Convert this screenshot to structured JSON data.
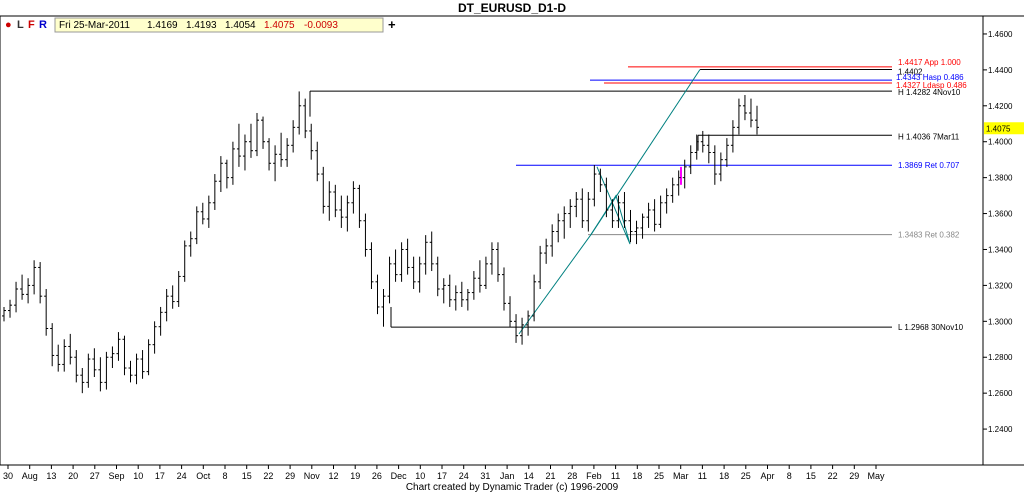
{
  "title": "DT_EURUSD_D1-D",
  "toolbar": {
    "dot": "●",
    "l": "L",
    "f": "F",
    "r": "R",
    "plus": "+"
  },
  "ohlc": {
    "date": "Fri 25-Mar-2011",
    "open": "1.4169",
    "high": "1.4193",
    "low": "1.4054",
    "close": "1.4075",
    "change": "-0.0093"
  },
  "footer": "Chart created by Dynamic Trader  (c) 1996-2009",
  "colors": {
    "background": "#ffffff",
    "ohlc_box": "#ffffcc",
    "price_label_bg": "#ffff00",
    "red_line": "#ff0000",
    "blue_line": "#0000ff",
    "teal_line": "#008080",
    "gray_line": "#888888",
    "magenta_bar": "#ff00ff"
  },
  "chart_data": {
    "type": "ohlc",
    "ylim": [
      1.22,
      1.47
    ],
    "y_ticks": [
      "1.4600",
      "1.4400",
      "1.4200",
      "1.4000",
      "1.3800",
      "1.3600",
      "1.3400",
      "1.3200",
      "1.3000",
      "1.2800",
      "1.2600",
      "1.2400"
    ],
    "x_ticks": [
      "30",
      "Aug",
      "13",
      "20",
      "27",
      "Sep",
      "10",
      "17",
      "24",
      "Oct",
      "8",
      "15",
      "22",
      "29",
      "Nov",
      "12",
      "19",
      "26",
      "Dec",
      "10",
      "17",
      "24",
      "31",
      "Jan",
      "14",
      "21",
      "28",
      "Feb",
      "11",
      "18",
      "25",
      "Mar",
      "11",
      "18",
      "25",
      "Apr",
      "8",
      "15",
      "22",
      "29",
      "May"
    ],
    "last_price": "1.4075",
    "bars": [
      [
        1.303,
        1.308,
        1.3,
        1.306
      ],
      [
        1.306,
        1.312,
        1.302,
        1.309
      ],
      [
        1.309,
        1.322,
        1.305,
        1.318
      ],
      [
        1.318,
        1.326,
        1.312,
        1.315
      ],
      [
        1.315,
        1.324,
        1.31,
        1.32
      ],
      [
        1.32,
        1.334,
        1.315,
        1.33
      ],
      [
        1.33,
        1.333,
        1.31,
        1.314
      ],
      [
        1.314,
        1.318,
        1.292,
        1.296
      ],
      [
        1.296,
        1.299,
        1.275,
        1.281
      ],
      [
        1.281,
        1.287,
        1.272,
        1.276
      ],
      [
        1.276,
        1.29,
        1.272,
        1.286
      ],
      [
        1.286,
        1.293,
        1.276,
        1.28
      ],
      [
        1.28,
        1.284,
        1.266,
        1.27
      ],
      [
        1.27,
        1.274,
        1.26,
        1.266
      ],
      [
        1.266,
        1.282,
        1.263,
        1.279
      ],
      [
        1.279,
        1.285,
        1.269,
        1.273
      ],
      [
        1.273,
        1.28,
        1.261,
        1.266
      ],
      [
        1.266,
        1.283,
        1.262,
        1.28
      ],
      [
        1.28,
        1.286,
        1.274,
        1.282
      ],
      [
        1.282,
        1.294,
        1.278,
        1.29
      ],
      [
        1.29,
        1.292,
        1.27,
        1.274
      ],
      [
        1.274,
        1.278,
        1.266,
        1.27
      ],
      [
        1.27,
        1.282,
        1.265,
        1.279
      ],
      [
        1.279,
        1.284,
        1.268,
        1.272
      ],
      [
        1.272,
        1.29,
        1.27,
        1.287
      ],
      [
        1.287,
        1.3,
        1.282,
        1.297
      ],
      [
        1.297,
        1.308,
        1.292,
        1.305
      ],
      [
        1.305,
        1.318,
        1.3,
        1.314
      ],
      [
        1.314,
        1.32,
        1.307,
        1.311
      ],
      [
        1.311,
        1.328,
        1.308,
        1.325
      ],
      [
        1.325,
        1.345,
        1.322,
        1.342
      ],
      [
        1.342,
        1.35,
        1.336,
        1.346
      ],
      [
        1.346,
        1.364,
        1.343,
        1.361
      ],
      [
        1.361,
        1.366,
        1.354,
        1.357
      ],
      [
        1.357,
        1.37,
        1.352,
        1.366
      ],
      [
        1.366,
        1.382,
        1.362,
        1.378
      ],
      [
        1.378,
        1.392,
        1.372,
        1.388
      ],
      [
        1.388,
        1.39,
        1.374,
        1.38
      ],
      [
        1.38,
        1.4,
        1.376,
        1.396
      ],
      [
        1.396,
        1.41,
        1.386,
        1.392
      ],
      [
        1.392,
        1.404,
        1.384,
        1.4
      ],
      [
        1.4,
        1.41,
        1.391,
        1.395
      ],
      [
        1.395,
        1.416,
        1.392,
        1.412
      ],
      [
        1.412,
        1.414,
        1.396,
        1.4
      ],
      [
        1.4,
        1.402,
        1.384,
        1.388
      ],
      [
        1.388,
        1.398,
        1.378,
        1.393
      ],
      [
        1.393,
        1.405,
        1.386,
        1.39
      ],
      [
        1.39,
        1.402,
        1.386,
        1.398
      ],
      [
        1.398,
        1.412,
        1.394,
        1.408
      ],
      [
        1.408,
        1.428,
        1.404,
        1.42
      ],
      [
        1.42,
        1.424,
        1.402,
        1.406
      ],
      [
        1.406,
        1.41,
        1.39,
        1.395
      ],
      [
        1.395,
        1.4,
        1.378,
        1.382
      ],
      [
        1.382,
        1.386,
        1.36,
        1.364
      ],
      [
        1.364,
        1.378,
        1.356,
        1.372
      ],
      [
        1.372,
        1.376,
        1.358,
        1.362
      ],
      [
        1.362,
        1.37,
        1.352,
        1.358
      ],
      [
        1.358,
        1.37,
        1.35,
        1.366
      ],
      [
        1.366,
        1.378,
        1.36,
        1.374
      ],
      [
        1.374,
        1.376,
        1.352,
        1.356
      ],
      [
        1.356,
        1.36,
        1.336,
        1.34
      ],
      [
        1.34,
        1.344,
        1.318,
        1.322
      ],
      [
        1.322,
        1.326,
        1.304,
        1.308
      ],
      [
        1.308,
        1.318,
        1.297,
        1.314
      ],
      [
        1.314,
        1.336,
        1.31,
        1.332
      ],
      [
        1.332,
        1.34,
        1.322,
        1.326
      ],
      [
        1.326,
        1.344,
        1.322,
        1.34
      ],
      [
        1.34,
        1.346,
        1.326,
        1.33
      ],
      [
        1.33,
        1.336,
        1.318,
        1.322
      ],
      [
        1.322,
        1.336,
        1.316,
        1.332
      ],
      [
        1.332,
        1.348,
        1.326,
        1.344
      ],
      [
        1.344,
        1.35,
        1.328,
        1.332
      ],
      [
        1.332,
        1.336,
        1.314,
        1.318
      ],
      [
        1.318,
        1.324,
        1.31,
        1.32
      ],
      [
        1.32,
        1.326,
        1.308,
        1.312
      ],
      [
        1.312,
        1.32,
        1.306,
        1.316
      ],
      [
        1.316,
        1.322,
        1.308,
        1.312
      ],
      [
        1.312,
        1.318,
        1.306,
        1.316
      ],
      [
        1.316,
        1.328,
        1.312,
        1.324
      ],
      [
        1.324,
        1.334,
        1.316,
        1.32
      ],
      [
        1.32,
        1.336,
        1.318,
        1.332
      ],
      [
        1.332,
        1.344,
        1.326,
        1.34
      ],
      [
        1.34,
        1.344,
        1.322,
        1.326
      ],
      [
        1.326,
        1.33,
        1.306,
        1.31
      ],
      [
        1.31,
        1.314,
        1.297,
        1.3
      ],
      [
        1.3,
        1.304,
        1.288,
        1.292
      ],
      [
        1.292,
        1.302,
        1.287,
        1.298
      ],
      [
        1.298,
        1.306,
        1.292,
        1.303
      ],
      [
        1.303,
        1.326,
        1.3,
        1.322
      ],
      [
        1.322,
        1.342,
        1.318,
        1.338
      ],
      [
        1.338,
        1.346,
        1.332,
        1.342
      ],
      [
        1.342,
        1.354,
        1.336,
        1.35
      ],
      [
        1.35,
        1.36,
        1.344,
        1.356
      ],
      [
        1.356,
        1.364,
        1.346,
        1.36
      ],
      [
        1.36,
        1.368,
        1.352,
        1.364
      ],
      [
        1.364,
        1.372,
        1.358,
        1.368
      ],
      [
        1.368,
        1.374,
        1.352,
        1.356
      ],
      [
        1.356,
        1.372,
        1.35,
        1.368
      ],
      [
        1.368,
        1.387,
        1.364,
        1.382
      ],
      [
        1.382,
        1.385,
        1.372,
        1.376
      ],
      [
        1.376,
        1.38,
        1.358,
        1.362
      ],
      [
        1.362,
        1.368,
        1.352,
        1.356
      ],
      [
        1.356,
        1.37,
        1.352,
        1.366
      ],
      [
        1.366,
        1.372,
        1.352,
        1.356
      ],
      [
        1.356,
        1.362,
        1.344,
        1.35
      ],
      [
        1.35,
        1.356,
        1.343,
        1.352
      ],
      [
        1.352,
        1.36,
        1.346,
        1.358
      ],
      [
        1.358,
        1.366,
        1.352,
        1.362
      ],
      [
        1.362,
        1.368,
        1.35,
        1.354
      ],
      [
        1.354,
        1.37,
        1.352,
        1.366
      ],
      [
        1.366,
        1.374,
        1.36,
        1.37
      ],
      [
        1.37,
        1.38,
        1.366,
        1.376
      ],
      [
        1.376,
        1.384,
        1.37,
        1.38
      ],
      [
        1.38,
        1.39,
        1.374,
        1.386
      ],
      [
        1.386,
        1.398,
        1.382,
        1.394
      ],
      [
        1.394,
        1.404,
        1.39,
        1.4
      ],
      [
        1.4,
        1.406,
        1.394,
        1.398
      ],
      [
        1.398,
        1.404,
        1.388,
        1.394
      ],
      [
        1.394,
        1.398,
        1.376,
        1.382
      ],
      [
        1.382,
        1.394,
        1.378,
        1.39
      ],
      [
        1.39,
        1.402,
        1.386,
        1.398
      ],
      [
        1.398,
        1.412,
        1.394,
        1.408
      ],
      [
        1.408,
        1.424,
        1.404,
        1.42
      ],
      [
        1.42,
        1.426,
        1.412,
        1.416
      ],
      [
        1.416,
        1.424,
        1.408,
        1.412
      ],
      [
        1.412,
        1.42,
        1.404,
        1.408
      ]
    ],
    "levels": [
      {
        "label": "1.4417 App 1.000",
        "value": 1.4417,
        "color": "#ff0000"
      },
      {
        "label": "1.4402",
        "value": 1.4402,
        "color": "#000000"
      },
      {
        "label": "1.4343 Hasp 0.486",
        "value": 1.4343,
        "color": "#0000ff"
      },
      {
        "label": "1.4327 Ldasp 0.486",
        "value": 1.4327,
        "color": "#ff0000"
      },
      {
        "label": "H 1.4282 4Nov10",
        "value": 1.4282,
        "color": "#000000"
      },
      {
        "label": "H 1.4036 7Mar11",
        "value": 1.4036,
        "color": "#000000"
      },
      {
        "label": "1.3869 Ret 0.707",
        "value": 1.3869,
        "color": "#0000ff"
      },
      {
        "label": "1.3483 Ret 0.382",
        "value": 1.3483,
        "color": "#888888"
      },
      {
        "label": "L 1.2968 30Nov10",
        "value": 1.2968,
        "color": "#000000"
      }
    ]
  }
}
